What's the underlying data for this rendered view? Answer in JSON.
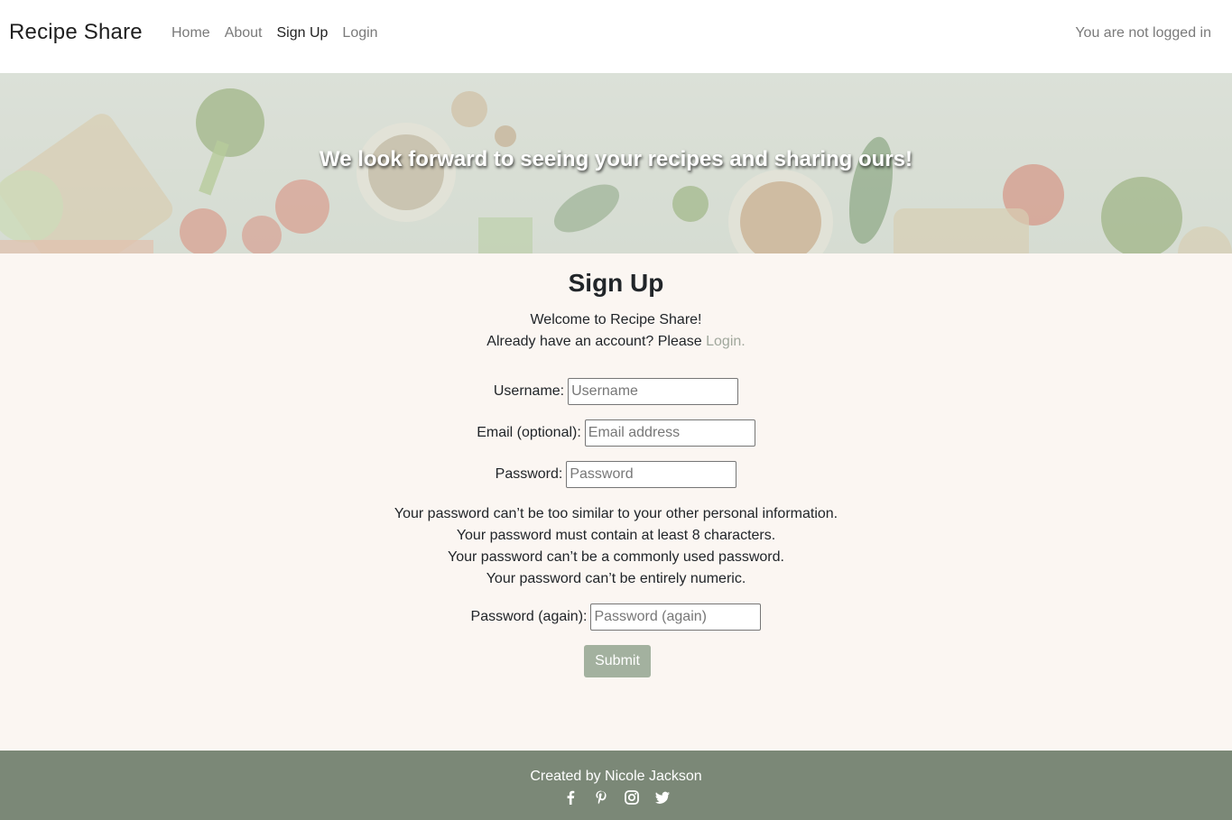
{
  "nav": {
    "brand": "Recipe Share",
    "links": [
      "Home",
      "About",
      "Sign Up",
      "Login"
    ],
    "status": "You are not logged in"
  },
  "hero": {
    "text": "We look forward to seeing your recipes and sharing ours!"
  },
  "main": {
    "title": "Sign Up",
    "welcome": "Welcome to Recipe Share!",
    "account_prefix": "Already have an account? Please",
    "account_link": "Login.",
    "fields": {
      "username": {
        "label": "Username:",
        "placeholder": "Username"
      },
      "email": {
        "label": "Email (optional):",
        "placeholder": "Email address"
      },
      "password": {
        "label": "Password:",
        "placeholder": "Password"
      },
      "password2": {
        "label": "Password (again):",
        "placeholder": "Password (again)"
      }
    },
    "help": [
      "Your password can’t be too similar to your other personal information.",
      "Your password must contain at least 8 characters.",
      "Your password can’t be a commonly used password.",
      "Your password can’t be entirely numeric."
    ],
    "submit": "Submit"
  },
  "footer": {
    "text": "Created by Nicole Jackson",
    "icons": [
      "facebook-icon",
      "pinterest-icon",
      "instagram-icon",
      "twitter-icon"
    ]
  },
  "colors": {
    "accent": "#a3b19f",
    "footer_bg": "#7b8877",
    "page_bg": "#fbf6f2"
  }
}
